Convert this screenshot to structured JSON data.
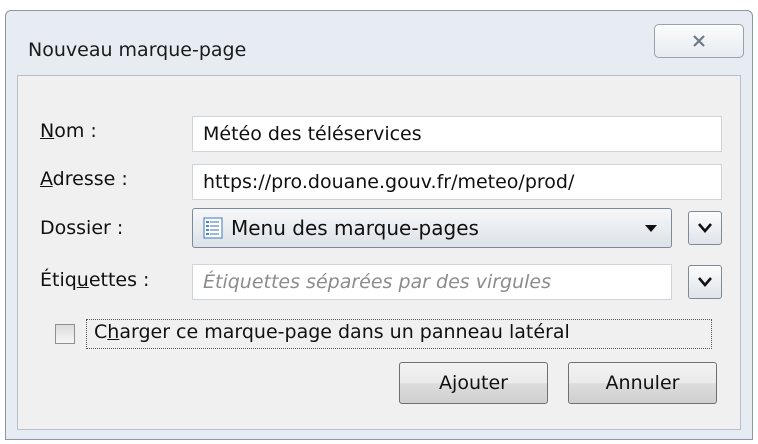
{
  "dialog": {
    "title": "Nouveau marque-page",
    "close_icon": "close-x-icon"
  },
  "form": {
    "name": {
      "label_accel": "N",
      "label_rest": "om :",
      "value": "Météo des téléservices"
    },
    "address": {
      "label_accel": "A",
      "label_rest": "dresse :",
      "value": "https://pro.douane.gouv.fr/meteo/prod/"
    },
    "folder": {
      "label": "Dossier :",
      "selected": "Menu des marque-pages",
      "icon": "bookmarks-menu-icon",
      "expand_icon": "chevron-down-icon"
    },
    "tags": {
      "label_pre": "Étiq",
      "label_accel": "u",
      "label_post": "ettes :",
      "placeholder": "Étiquettes séparées par des virgules",
      "expand_icon": "chevron-down-icon"
    },
    "sidebar_option": {
      "label_pre": "C",
      "label_accel": "h",
      "label_post": "arger ce marque-page dans un panneau latéral",
      "checked": false
    }
  },
  "buttons": {
    "add": "Ajouter",
    "cancel": "Annuler"
  }
}
